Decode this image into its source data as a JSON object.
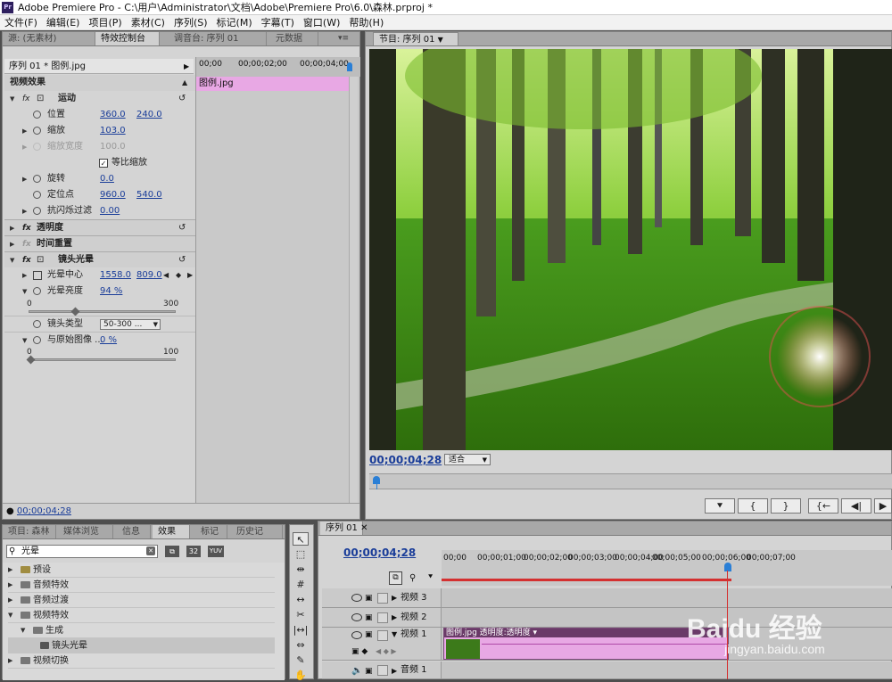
{
  "window": {
    "icon": "Pr",
    "title": "Adobe Premiere Pro - C:\\用户\\Administrator\\文档\\Adobe\\Premiere Pro\\6.0\\森林.prproj *"
  },
  "menu": [
    "文件(F)",
    "编辑(E)",
    "项目(P)",
    "素材(C)",
    "序列(S)",
    "标记(M)",
    "字幕(T)",
    "窗口(W)",
    "帮助(H)"
  ],
  "top_left_tabs": [
    "源: (无素材)",
    "特效控制台",
    "调音台: 序列 01",
    "元数据"
  ],
  "effects_panel": {
    "clip_label": "序列 01 * 图例.jpg",
    "ruler": [
      "00;00",
      "00;00;02;00",
      "00;00;04;00"
    ],
    "clip_bar": "图例.jpg",
    "section_video": "视频效果",
    "motion": "运动",
    "position": {
      "label": "位置",
      "x": "360.0",
      "y": "240.0"
    },
    "scale": {
      "label": "缩放",
      "value": "103.0"
    },
    "scale_width": {
      "label": "缩放宽度",
      "value": "100.0"
    },
    "uniform": "等比缩放",
    "rotation": {
      "label": "旋转",
      "value": "0.0"
    },
    "anchor": {
      "label": "定位点",
      "x": "960.0",
      "y": "540.0"
    },
    "antiflicker": {
      "label": "抗闪烁过滤",
      "value": "0.00"
    },
    "opacity": "透明度",
    "time_remap": "时间重置",
    "lens_flare": "镜头光晕",
    "flare_center": {
      "label": "光晕中心",
      "x": "1558.0",
      "y": "809.0"
    },
    "flare_brightness": {
      "label": "光晕亮度",
      "value": "94 %",
      "min": "0",
      "max": "300",
      "level": 94
    },
    "lens_type": {
      "label": "镜头类型",
      "value": "50-300 ..."
    },
    "blend": {
      "label": "与原始图像 ...",
      "value": "0 %",
      "min": "0",
      "max": "100",
      "level": 0
    },
    "timecode": "00;00;04;28"
  },
  "program": {
    "tab": "节目: 序列 01",
    "timecode": "00;00;04;28",
    "fit": "适合"
  },
  "project_tabs": [
    "项目: 森林",
    "媒体浏览",
    "信息",
    "效果",
    "标记",
    "历史记"
  ],
  "effects_search": {
    "value": "光晕",
    "btn1": "32",
    "btn2": "YUV"
  },
  "effects_tree": [
    "预设",
    "音频特效",
    "音频过渡",
    "视频特效",
    "生成",
    "镜头光晕",
    "视频切换"
  ],
  "timeline": {
    "tab": "序列 01",
    "timecode": "00;00;04;28",
    "ruler": [
      "00;00",
      "00;00;01;00",
      "00;00;02;00",
      "00;00;03;00",
      "00;00;04;00",
      "00;00;05;00",
      "00;00;06;00",
      "00;00;07;00"
    ],
    "tracks": [
      "视频 3",
      "视频 2",
      "视频 1",
      "音频 1"
    ],
    "clip": "图例.jpg  透明度:透明度 ▾"
  },
  "watermark": {
    "brand": "Baidu 经验",
    "url": "jingyan.baidu.com"
  }
}
